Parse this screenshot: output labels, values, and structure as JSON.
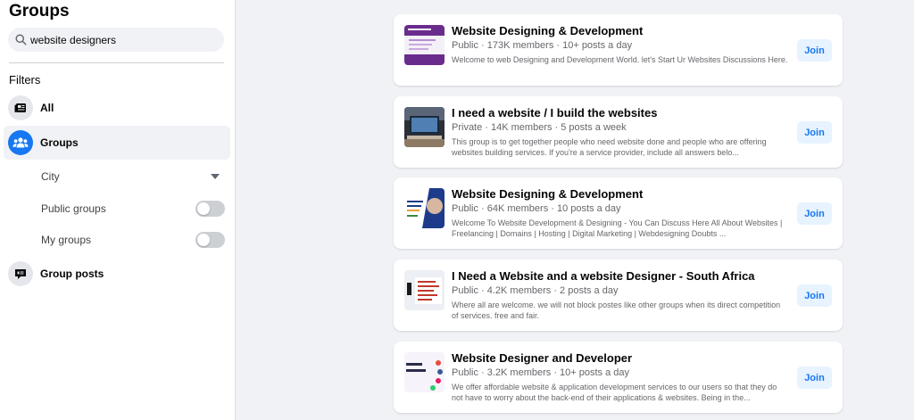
{
  "sidebar": {
    "title": "Groups",
    "search": {
      "value": "website designers",
      "icon": "search-icon"
    },
    "filters_title": "Filters",
    "nav": [
      {
        "label": "All",
        "icon": "feed-icon"
      },
      {
        "label": "Groups",
        "icon": "groups-icon",
        "active": true
      },
      {
        "label": "Group posts",
        "icon": "group-posts-icon"
      }
    ],
    "sub_filters": {
      "city": {
        "label": "City",
        "icon": "caret-down-icon"
      },
      "public_groups": {
        "label": "Public groups",
        "checked": false
      },
      "my_groups": {
        "label": "My groups",
        "checked": false
      }
    }
  },
  "results": [
    {
      "title": "Website Designing & Development",
      "meta": "Public · 173K members · 10+ posts a day",
      "description": "Welcome to web Designing and Development World. let's Start Ur Websites Discussions Here.",
      "join_label": "Join"
    },
    {
      "title": "I need a website / I build the websites",
      "meta": "Private · 14K members · 5 posts a week",
      "description": "This group is to get together people who need website done and people who are offering websites building services. If you're a service provider, include all answers belo...",
      "join_label": "Join"
    },
    {
      "title": "Website Designing & Development",
      "meta": "Public · 64K members · 10 posts a day",
      "description": "Welcome To Website Development & Designing - You Can Discuss Here All About Websites | Freelancing | Domains | Hosting | Digital Marketing | Webdesigning Doubts ...",
      "join_label": "Join"
    },
    {
      "title": "I Need a Website and a website Designer - South Africa",
      "meta": "Public · 4.2K members · 2 posts a day",
      "description": "Where all are welcome. we will not block postes like other groups when its direct competition of services. free and fair.",
      "join_label": "Join"
    },
    {
      "title": "Website Designer and Developer",
      "meta": "Public · 3.2K members · 10+ posts a day",
      "description": "We offer affordable website & application development services to our users so that they do not have to worry about the back-end of their applications & websites. Being in the...",
      "join_label": "Join"
    }
  ],
  "colors": {
    "accent": "#1877f2",
    "join_bg": "#e7f3ff",
    "page_bg": "#f0f2f5"
  }
}
